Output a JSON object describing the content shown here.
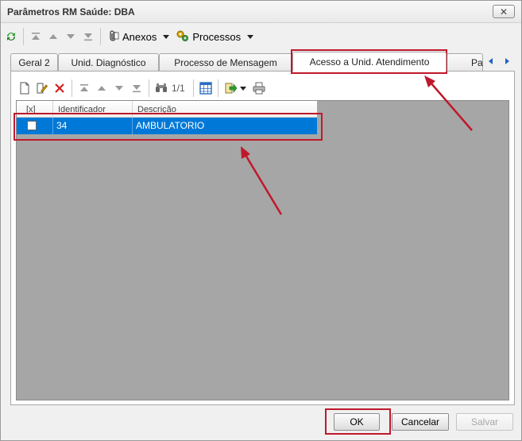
{
  "window": {
    "title": "Parâmetros RM Saúde: DBA",
    "close_symbol": "✕"
  },
  "toolbar": {
    "anexos_label": "Anexos",
    "processos_label": "Processos"
  },
  "tabs": [
    {
      "label": "Geral 2",
      "active": false
    },
    {
      "label": "Unid. Diagnóstico",
      "active": false
    },
    {
      "label": "Processo de Mensagem",
      "active": false
    },
    {
      "label": "Acesso a Unid. Atendimento",
      "active": true
    },
    {
      "label": "Pa",
      "active": false
    }
  ],
  "grid_toolbar": {
    "page_indicator": "1/1"
  },
  "grid": {
    "columns": [
      "[x]",
      "Identificador",
      "Descrição"
    ],
    "rows": [
      {
        "checked": false,
        "identificador": "34",
        "descricao": "AMBULATORIO",
        "selected": true
      }
    ]
  },
  "footer": {
    "ok_label": "OK",
    "cancel_label": "Cancelar",
    "save_label": "Salvar"
  },
  "colors": {
    "selection": "#0078d7",
    "annotation_red": "#c0182b",
    "grid_background": "#a6a6a6"
  }
}
